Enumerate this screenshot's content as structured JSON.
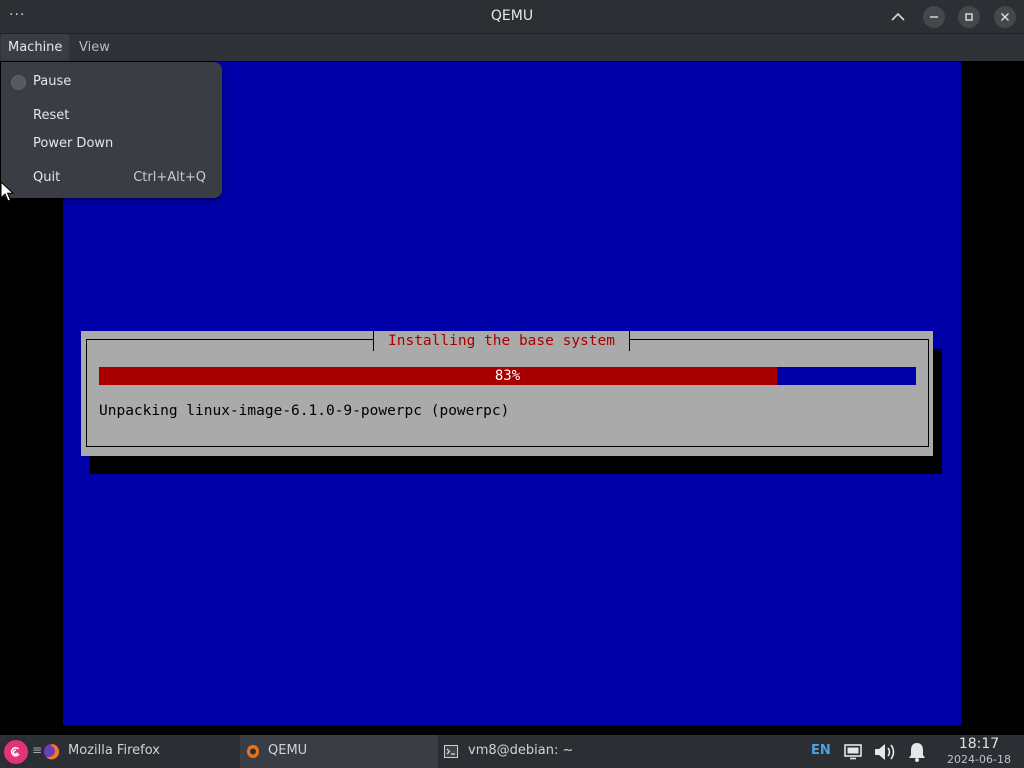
{
  "window": {
    "title": "QEMU"
  },
  "menubar": {
    "items": [
      "Machine",
      "View"
    ]
  },
  "machine_menu": {
    "items": [
      {
        "label": "Pause",
        "type": "checkbox",
        "checked": false
      },
      {
        "label": "Reset"
      },
      {
        "label": "Power Down"
      },
      {
        "label": "Quit",
        "shortcut": "Ctrl+Alt+Q"
      }
    ]
  },
  "installer": {
    "title": "Installing the base system",
    "progress_percent": 83,
    "progress_label": "83%",
    "status": "Unpacking linux-image-6.1.0-9-powerpc (powerpc)",
    "colors": {
      "background": "#0000a8",
      "dialog": "#aaaaaa",
      "bar_fill": "#a80000",
      "title_text": "#a80000"
    }
  },
  "taskbar": {
    "tasks": [
      {
        "label": "Mozilla Firefox",
        "icon": "firefox-icon"
      },
      {
        "label": "QEMU",
        "icon": "qemu-icon",
        "active": true
      },
      {
        "label": "vm8@debian: ~",
        "icon": "terminal-icon"
      }
    ],
    "tray": {
      "keyboard_layout": "EN"
    },
    "clock": {
      "time": "18:17",
      "date": "2024-06-18"
    }
  }
}
